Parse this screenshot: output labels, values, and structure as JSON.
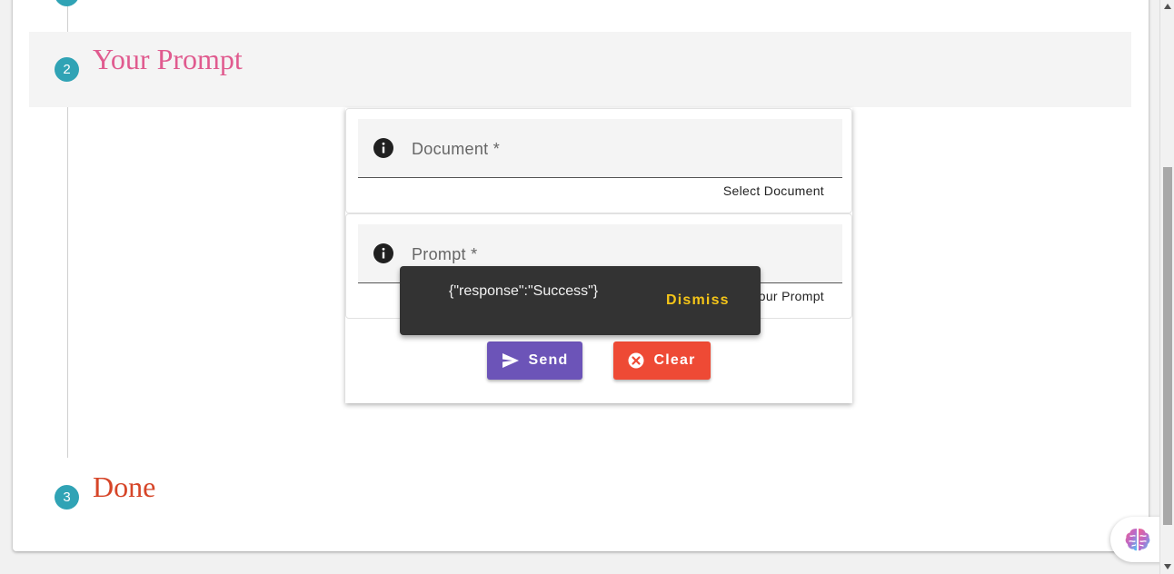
{
  "steps": [
    {
      "number": "2",
      "title": "Your Prompt",
      "color": "#e05b8f"
    },
    {
      "number": "3",
      "title": "Done",
      "color": "#d64528"
    }
  ],
  "colors": {
    "step_badge": "#30a3b5",
    "prev_step_title": "#30a3b5",
    "send_button": "#6c54b8",
    "clear_button": "#ee4a35",
    "dismiss_text": "#f5c518"
  },
  "form": {
    "document": {
      "label": "Document *",
      "hint": "Select Document",
      "icon": "info-icon"
    },
    "prompt": {
      "label": "Prompt *",
      "hint": "Your Prompt",
      "icon": "info-icon"
    },
    "send_label": "Send",
    "clear_label": "Clear"
  },
  "snackbar": {
    "message": "{\"response\":\"Success\"}",
    "action": "Dismiss"
  },
  "fab": {
    "icon": "brain-icon"
  }
}
